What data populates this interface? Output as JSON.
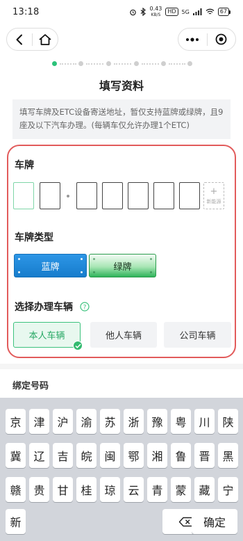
{
  "status_bar": {
    "time": "13:18",
    "net_speed_value": "0.43",
    "net_speed_unit": "KB/S",
    "hd_badge": "HD",
    "network": "5G",
    "battery": "67"
  },
  "page": {
    "title": "填写资料",
    "notice": "填写车牌及ETC设备寄送地址，暂仅支持蓝牌或绿牌，且9座及以下汽车办理。(每辆车仅允许办理1个ETC)"
  },
  "form": {
    "plate_label": "车牌",
    "plate_new_energy_label": "新能源",
    "plate_new_energy_plus": "+",
    "plate_type_label": "车牌类型",
    "plate_types": [
      "蓝牌",
      "绿牌"
    ],
    "vehicle_label": "选择办理车辆",
    "vehicle_options": [
      "本人车辆",
      "他人车辆",
      "公司车辆"
    ],
    "bind_label": "绑定号码"
  },
  "keyboard": {
    "row1": [
      "京",
      "津",
      "沪",
      "渝",
      "苏",
      "浙",
      "豫",
      "粤",
      "川",
      "陕"
    ],
    "row2": [
      "冀",
      "辽",
      "吉",
      "皖",
      "闽",
      "鄂",
      "湘",
      "鲁",
      "晋",
      "黑"
    ],
    "row3": [
      "赣",
      "贵",
      "甘",
      "桂",
      "琼",
      "云",
      "青",
      "蒙",
      "藏",
      "宁"
    ],
    "row4_key": "新",
    "confirm": "确定"
  },
  "colors": {
    "accent_green": "#2cc27a",
    "highlight_red": "#e25b5b",
    "blue_plate": "#1a85d6",
    "green_plate": "#2fb35a"
  }
}
